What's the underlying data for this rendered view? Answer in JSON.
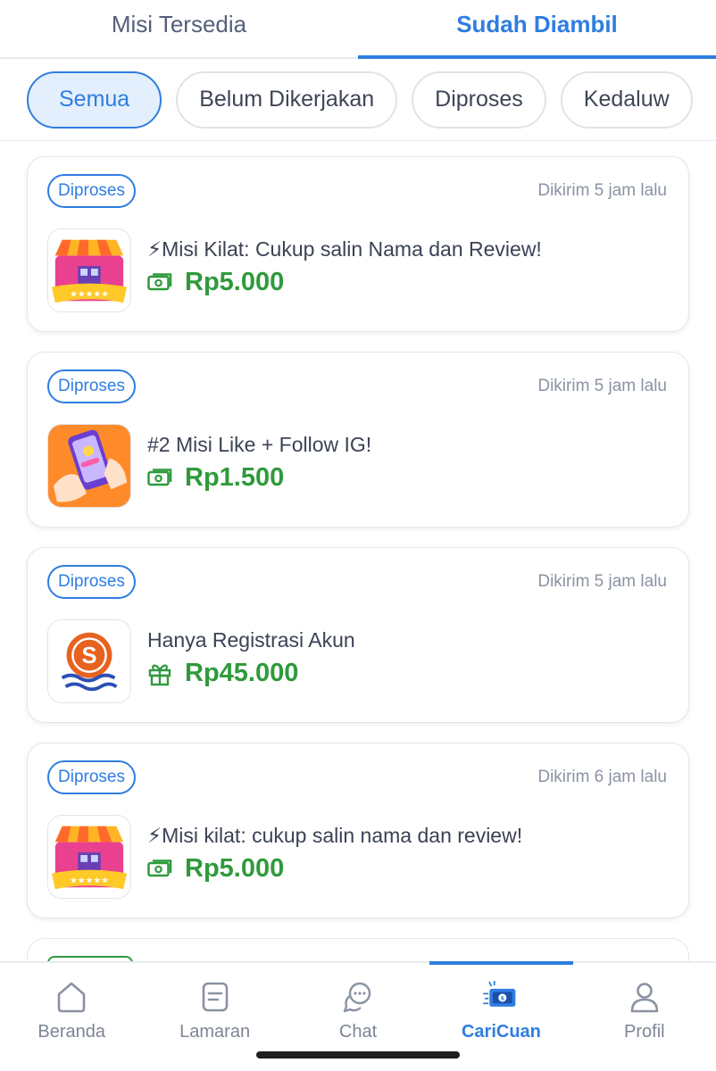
{
  "top_tabs": [
    {
      "label": "Misi Tersedia",
      "active": false
    },
    {
      "label": "Sudah Diambil",
      "active": true
    }
  ],
  "filters": [
    {
      "label": "Semua",
      "active": true
    },
    {
      "label": "Belum Dikerjakan",
      "active": false
    },
    {
      "label": "Diproses",
      "active": false
    },
    {
      "label": "Kedaluw",
      "active": false
    }
  ],
  "missions": [
    {
      "status": "Diproses",
      "time": "Dikirim 5 jam lalu",
      "title": "⚡Misi Kilat: Cukup salin Nama dan Review!",
      "amount": "Rp5.000",
      "thumb_icon": "store-icon",
      "reward_icon": "cash-icon"
    },
    {
      "status": "Diproses",
      "time": "Dikirim 5 jam lalu",
      "title": "#2 Misi Like + Follow IG!",
      "amount": "Rp1.500",
      "thumb_icon": "phone-hands-icon",
      "reward_icon": "cash-icon"
    },
    {
      "status": "Diproses",
      "time": "Dikirim 5 jam lalu",
      "title": "Hanya Registrasi Akun",
      "amount": "Rp45.000",
      "thumb_icon": "s-coin-logo-icon",
      "reward_icon": "gift-icon"
    },
    {
      "status": "Diproses",
      "time": "Dikirim 6 jam lalu",
      "title": "⚡Misi kilat: cukup salin nama dan review!",
      "amount": "Rp5.000",
      "thumb_icon": "store-icon",
      "reward_icon": "cash-icon"
    }
  ],
  "bottom_nav": [
    {
      "label": "Beranda",
      "icon": "home-icon",
      "active": false
    },
    {
      "label": "Lamaran",
      "icon": "document-icon",
      "active": false
    },
    {
      "label": "Chat",
      "icon": "chat-icon",
      "active": false
    },
    {
      "label": "CariCuan",
      "icon": "money-card-icon",
      "active": true
    },
    {
      "label": "Profil",
      "icon": "profile-icon",
      "active": false
    }
  ],
  "colors": {
    "accent": "#2f7de1",
    "reward": "#2f9a3c",
    "muted": "#8a93a3"
  }
}
